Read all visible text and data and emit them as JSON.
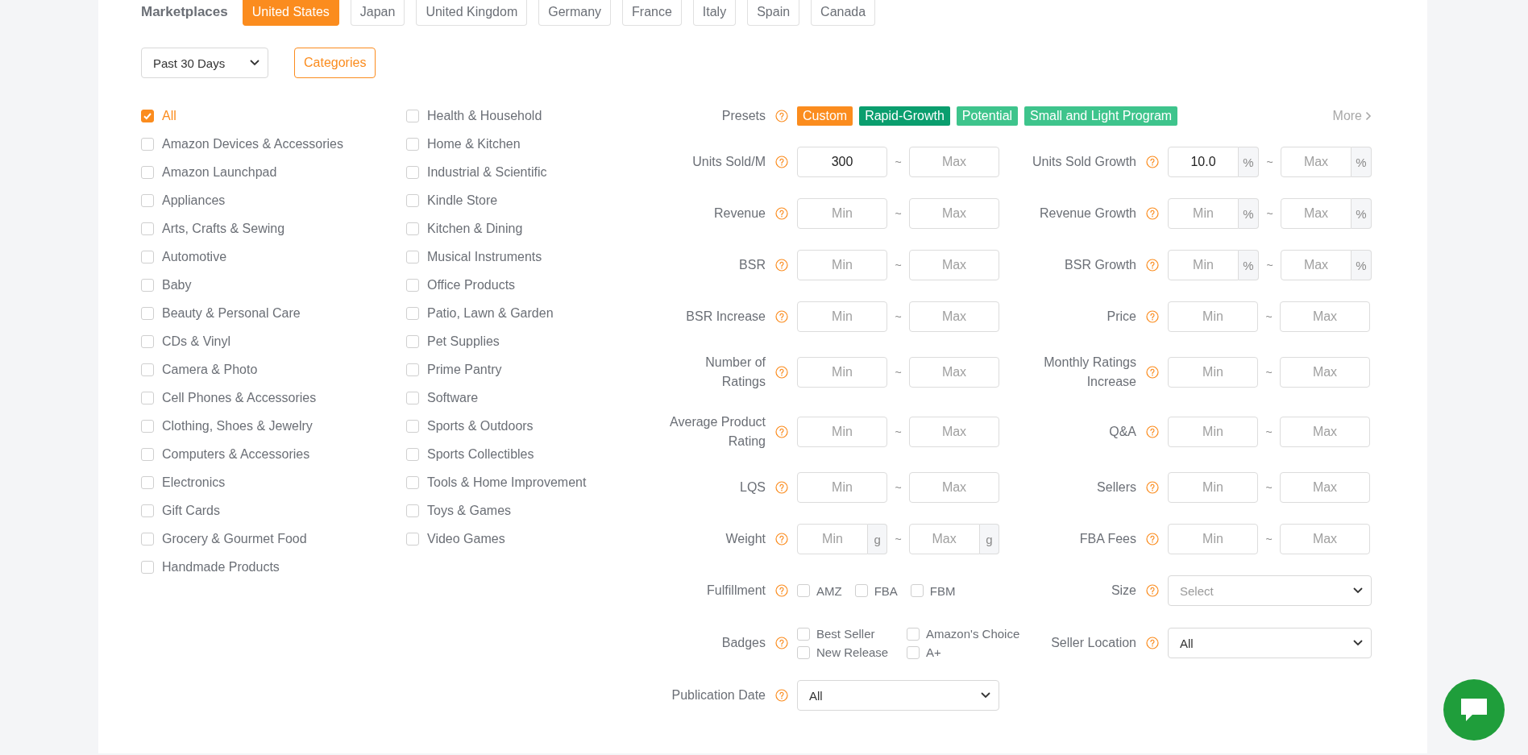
{
  "marketplaces": {
    "label": "Marketplaces",
    "items": [
      {
        "label": "United States",
        "selected": true
      },
      {
        "label": "Japan",
        "selected": false
      },
      {
        "label": "United Kingdom",
        "selected": false
      },
      {
        "label": "Germany",
        "selected": false
      },
      {
        "label": "France",
        "selected": false
      },
      {
        "label": "Italy",
        "selected": false
      },
      {
        "label": "Spain",
        "selected": false
      },
      {
        "label": "Canada",
        "selected": false
      }
    ]
  },
  "period_select": {
    "value": "Past 30 Days"
  },
  "categories_button": {
    "label": "Categories"
  },
  "categories": {
    "columns": [
      [
        {
          "label": "All",
          "checked": true
        },
        {
          "label": "Amazon Devices & Accessories",
          "checked": false
        },
        {
          "label": "Amazon Launchpad",
          "checked": false
        },
        {
          "label": "Appliances",
          "checked": false
        },
        {
          "label": "Arts, Crafts & Sewing",
          "checked": false
        },
        {
          "label": "Automotive",
          "checked": false
        },
        {
          "label": "Baby",
          "checked": false
        },
        {
          "label": "Beauty & Personal Care",
          "checked": false
        },
        {
          "label": "CDs & Vinyl",
          "checked": false
        },
        {
          "label": "Camera & Photo",
          "checked": false
        },
        {
          "label": "Cell Phones & Accessories",
          "checked": false
        },
        {
          "label": "Clothing, Shoes & Jewelry",
          "checked": false
        },
        {
          "label": "Computers & Accessories",
          "checked": false
        },
        {
          "label": "Electronics",
          "checked": false
        },
        {
          "label": "Gift Cards",
          "checked": false
        },
        {
          "label": "Grocery & Gourmet Food",
          "checked": false
        },
        {
          "label": "Handmade Products",
          "checked": false
        }
      ],
      [
        {
          "label": "Health & Household",
          "checked": false
        },
        {
          "label": "Home & Kitchen",
          "checked": false
        },
        {
          "label": "Industrial & Scientific",
          "checked": false
        },
        {
          "label": "Kindle Store",
          "checked": false
        },
        {
          "label": "Kitchen & Dining",
          "checked": false
        },
        {
          "label": "Musical Instruments",
          "checked": false
        },
        {
          "label": "Office Products",
          "checked": false
        },
        {
          "label": "Patio, Lawn & Garden",
          "checked": false
        },
        {
          "label": "Pet Supplies",
          "checked": false
        },
        {
          "label": "Prime Pantry",
          "checked": false
        },
        {
          "label": "Software",
          "checked": false
        },
        {
          "label": "Sports & Outdoors",
          "checked": false
        },
        {
          "label": "Sports Collectibles",
          "checked": false
        },
        {
          "label": "Tools & Home Improvement",
          "checked": false
        },
        {
          "label": "Toys & Games",
          "checked": false
        },
        {
          "label": "Video Games",
          "checked": false
        }
      ]
    ]
  },
  "presets": {
    "label": "Presets",
    "tags": [
      {
        "label": "Custom",
        "color": "#fb8c1e"
      },
      {
        "label": "Rapid-Growth",
        "color": "#0a9e6e"
      },
      {
        "label": "Potential",
        "color": "#3ec48c"
      },
      {
        "label": "Small and Light Program",
        "color": "#3ec48c"
      }
    ],
    "more": "More"
  },
  "filter_rows": [
    {
      "left": {
        "kind": "range",
        "label": "Units Sold/M",
        "min": {
          "value": "300"
        },
        "separator": "~",
        "max": {
          "placeholder": "Max"
        }
      },
      "right": {
        "kind": "range",
        "label": "Units Sold Growth",
        "min": {
          "value": "10.0",
          "unit": "%"
        },
        "separator": "~",
        "max": {
          "placeholder": "Max",
          "unit": "%"
        }
      }
    },
    {
      "left": {
        "kind": "range",
        "label": "Revenue",
        "min": {
          "placeholder": "Min"
        },
        "separator": "~",
        "max": {
          "placeholder": "Max"
        }
      },
      "right": {
        "kind": "range",
        "label": "Revenue Growth",
        "min": {
          "placeholder": "Min",
          "unit": "%"
        },
        "separator": "~",
        "max": {
          "placeholder": "Max",
          "unit": "%"
        }
      }
    },
    {
      "left": {
        "kind": "range",
        "label": "BSR",
        "min": {
          "placeholder": "Min"
        },
        "separator": "~",
        "max": {
          "placeholder": "Max"
        }
      },
      "right": {
        "kind": "range",
        "label": "BSR Growth",
        "min": {
          "placeholder": "Min",
          "unit": "%"
        },
        "separator": "~",
        "max": {
          "placeholder": "Max",
          "unit": "%"
        }
      }
    },
    {
      "left": {
        "kind": "range",
        "label": "BSR Increase",
        "min": {
          "placeholder": "Min"
        },
        "separator": "~",
        "max": {
          "placeholder": "Max"
        }
      },
      "right": {
        "kind": "range",
        "label": "Price",
        "min": {
          "placeholder": "Min"
        },
        "separator": "~",
        "max": {
          "placeholder": "Max"
        }
      }
    },
    {
      "left": {
        "kind": "range",
        "label": "Number of Ratings",
        "min": {
          "placeholder": "Min"
        },
        "separator": "~",
        "max": {
          "placeholder": "Max"
        }
      },
      "right": {
        "kind": "range",
        "label": "Monthly Ratings Increase",
        "min": {
          "placeholder": "Min"
        },
        "separator": "~",
        "max": {
          "placeholder": "Max"
        }
      }
    },
    {
      "left": {
        "kind": "range",
        "label": "Average Product Rating",
        "min": {
          "placeholder": "Min"
        },
        "separator": "~",
        "max": {
          "placeholder": "Max"
        }
      },
      "right": {
        "kind": "range",
        "label": "Q&A",
        "min": {
          "placeholder": "Min"
        },
        "separator": "~",
        "max": {
          "placeholder": "Max"
        }
      }
    },
    {
      "left": {
        "kind": "range",
        "label": "LQS",
        "min": {
          "placeholder": "Min"
        },
        "separator": "~",
        "max": {
          "placeholder": "Max"
        }
      },
      "right": {
        "kind": "range",
        "label": "Sellers",
        "min": {
          "placeholder": "Min"
        },
        "separator": "~",
        "max": {
          "placeholder": "Max"
        }
      }
    },
    {
      "left": {
        "kind": "range",
        "label": "Weight",
        "min": {
          "placeholder": "Min",
          "unit": "g"
        },
        "separator": "~",
        "max": {
          "placeholder": "Max",
          "unit": "g"
        }
      },
      "right": {
        "kind": "range",
        "label": "FBA Fees",
        "min": {
          "placeholder": "Min"
        },
        "separator": "~",
        "max": {
          "placeholder": "Max"
        }
      }
    },
    {
      "left": {
        "kind": "checks",
        "label": "Fulfillment",
        "options": [
          {
            "label": "AMZ",
            "checked": false
          },
          {
            "label": "FBA",
            "checked": false
          },
          {
            "label": "FBM",
            "checked": false
          }
        ]
      },
      "right": {
        "kind": "select",
        "label": "Size",
        "placeholder": "Select"
      }
    },
    {
      "left": {
        "kind": "checkgrid",
        "label": "Badges",
        "options": [
          {
            "label": "Best Seller",
            "checked": false
          },
          {
            "label": "Amazon's Choice",
            "checked": false
          },
          {
            "label": "New Release",
            "checked": false
          },
          {
            "label": "A+",
            "checked": false
          }
        ]
      },
      "right": {
        "kind": "select",
        "label": "Seller Location",
        "value": "All"
      }
    },
    {
      "left": {
        "kind": "select",
        "label": "Publication Date",
        "value": "All"
      }
    }
  ]
}
